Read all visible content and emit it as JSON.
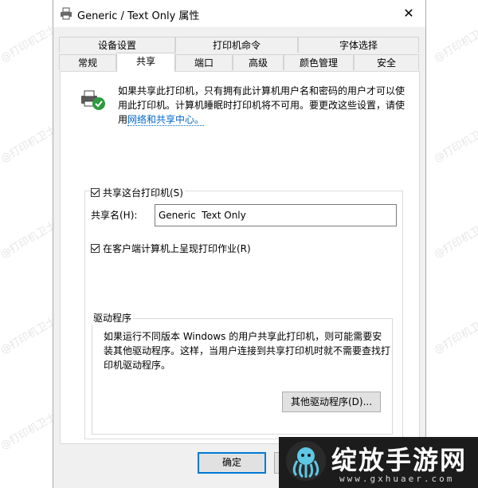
{
  "watermark": "@打印机卫士",
  "window": {
    "title": "Generic / Text Only 属性",
    "close_glyph": "✕"
  },
  "tabs_top": [
    "设备设置",
    "打印机命令",
    "字体选择"
  ],
  "tabs_bottom": [
    "常规",
    "共享",
    "端口",
    "高级",
    "颜色管理",
    "安全"
  ],
  "active_tab": "共享",
  "share": {
    "description": "如果共享此打印机，只有拥有此计算机用户名和密码的用户才可以使用此打印机。计算机睡眠时打印机将不可用。要更改这些设置，请使用",
    "link": "网络和共享中心。",
    "share_checkbox_label": "共享这台打印机(S)",
    "share_name_label": "共享名(H):",
    "share_name_value": "Generic  Text Only",
    "render_checkbox_label": "在客户端计算机上呈现打印作业(R)"
  },
  "drivers": {
    "legend": "驱动程序",
    "description": "如果运行不同版本 Windows 的用户共享此打印机，则可能需要安装其他驱动程序。这样，当用户连接到共享打印机时就不需要查找打印机驱动程序。",
    "button": "其他驱动程序(D)..."
  },
  "footer": {
    "ok": "确定"
  },
  "badge": {
    "title": "绽放手游网",
    "subtitle": "www.gxhuaer.com"
  },
  "colors": {
    "accent": "#0078d7",
    "link": "#0066cc",
    "panel": "#ffffff",
    "dialog": "#f0f0f0"
  }
}
